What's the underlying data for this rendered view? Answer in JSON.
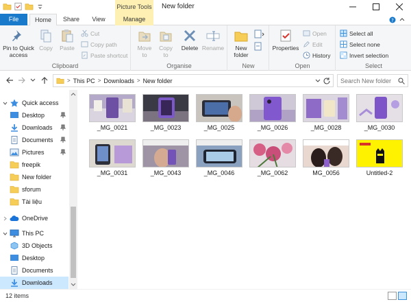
{
  "window": {
    "title": "New folder",
    "context_tab": "Picture Tools"
  },
  "tabs": {
    "file": "File",
    "home": "Home",
    "share": "Share",
    "view": "View",
    "manage": "Manage"
  },
  "ribbon": {
    "clipboard": {
      "label": "Clipboard",
      "pin": "Pin to Quick access",
      "copy": "Copy",
      "paste": "Paste",
      "cut": "Cut",
      "copy_path": "Copy path",
      "paste_shortcut": "Paste shortcut"
    },
    "organise": {
      "label": "Organise",
      "move_to": "Move to",
      "copy_to": "Copy to",
      "delete": "Delete",
      "rename": "Rename"
    },
    "new": {
      "label": "New",
      "new_folder": "New folder"
    },
    "open": {
      "label": "Open",
      "properties": "Properties",
      "open": "Open",
      "edit": "Edit",
      "history": "History"
    },
    "select": {
      "label": "Select",
      "select_all": "Select all",
      "select_none": "Select none",
      "invert": "Invert selection"
    }
  },
  "address": {
    "crumbs": [
      "This PC",
      "Downloads",
      "New folder"
    ],
    "search_placeholder": "Search New folder"
  },
  "nav": {
    "quick_access": "Quick access",
    "items": [
      "Desktop",
      "Downloads",
      "Documents",
      "Pictures",
      "freepik",
      "New folder",
      "sforum",
      "Tài liệu"
    ],
    "onedrive": "OneDrive",
    "this_pc": "This PC",
    "pc_items": [
      "3D Objects",
      "Desktop",
      "Documents",
      "Downloads"
    ]
  },
  "files": [
    {
      "name": "_MG_0021"
    },
    {
      "name": "_MG_0023"
    },
    {
      "name": "_MG_0025"
    },
    {
      "name": "_MG_0026"
    },
    {
      "name": "_MG_0028"
    },
    {
      "name": "_MG_0030"
    },
    {
      "name": "_MG_0031"
    },
    {
      "name": "_MG_0043"
    },
    {
      "name": "_MG_0046"
    },
    {
      "name": "_MG_0062"
    },
    {
      "name": "MG_0056"
    },
    {
      "name": "Untitled-2"
    }
  ],
  "status": {
    "count": "12 items"
  },
  "colors": {
    "accent": "#1979ca",
    "context": "#fdf0b2",
    "selection": "#cce8ff"
  }
}
